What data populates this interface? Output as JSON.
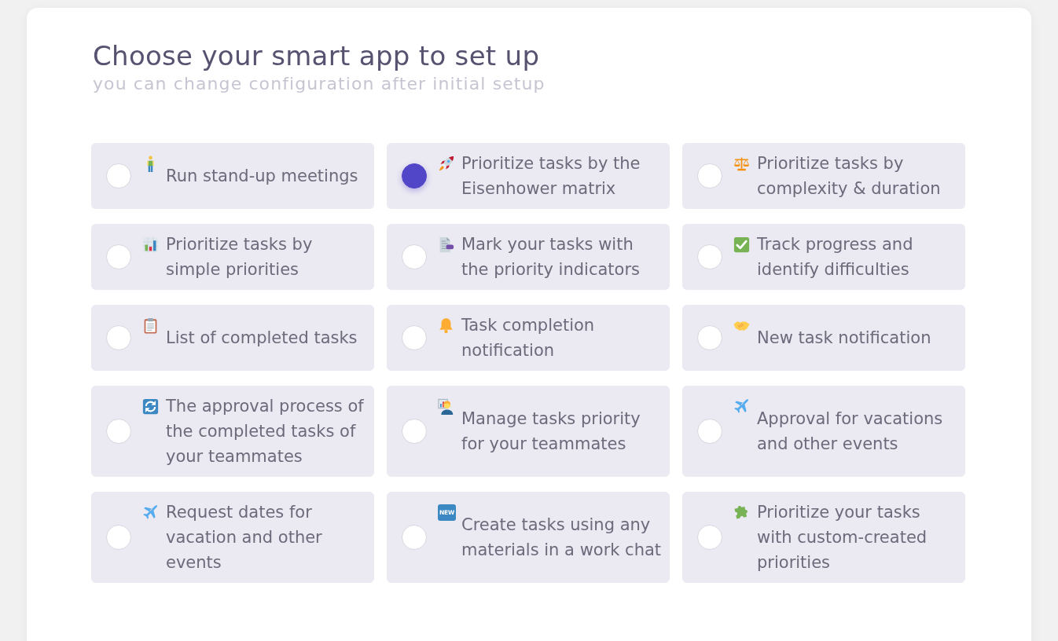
{
  "header": {
    "title": "Choose your smart app to set up",
    "subtitle": "you can change configuration after initial setup"
  },
  "options": [
    {
      "label": "Run stand-up meetings",
      "selected": false
    },
    {
      "label": "Prioritize tasks by the Eisenhower matrix",
      "selected": true
    },
    {
      "label": "Prioritize tasks by complexity & duration",
      "selected": false
    },
    {
      "label": "Prioritize tasks by simple priorities",
      "selected": false
    },
    {
      "label": "Mark your tasks with the priority indicators",
      "selected": false
    },
    {
      "label": "Track progress and identify difficulties",
      "selected": false
    },
    {
      "label": "List of completed tasks",
      "selected": false
    },
    {
      "label": "Task completion notification",
      "selected": false
    },
    {
      "label": "New task notification",
      "selected": false
    },
    {
      "label": "The approval process of the completed tasks of your teammates",
      "selected": false
    },
    {
      "label": "Manage tasks priority for your teammates",
      "selected": false
    },
    {
      "label": "Approval for vacations and other events",
      "selected": false
    },
    {
      "label": "Request dates for vacation and other events",
      "selected": false
    },
    {
      "label": "Create tasks using any materials in a work chat",
      "selected": false,
      "badge": "NEW"
    },
    {
      "label": "Prioritize your tasks with custom-created priorities",
      "selected": false
    }
  ]
}
